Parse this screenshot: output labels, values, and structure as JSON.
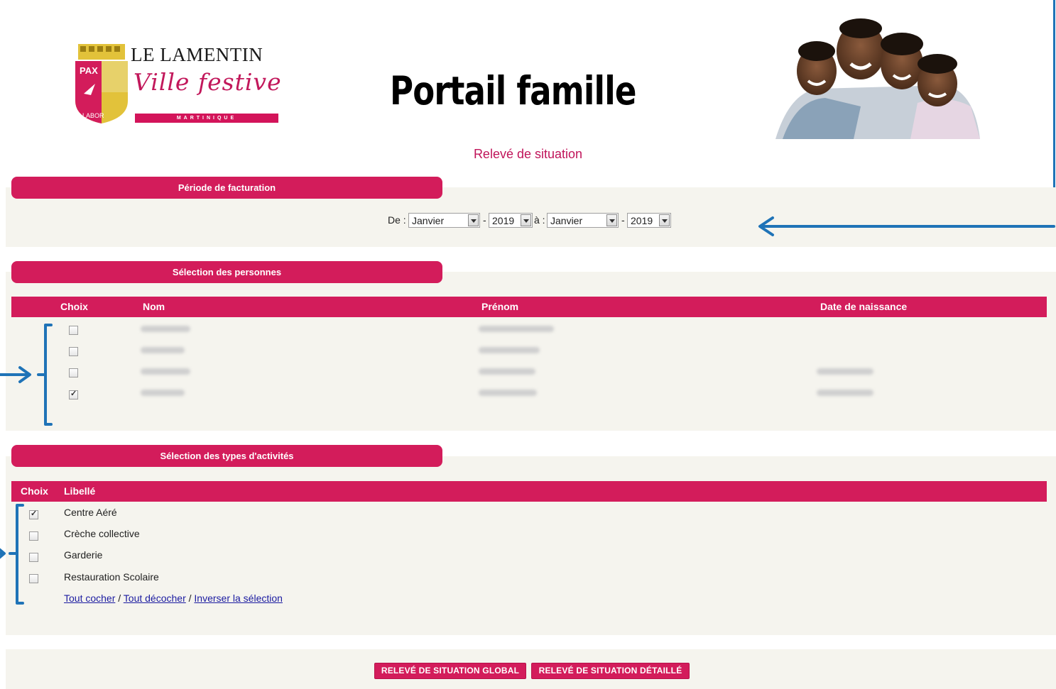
{
  "header": {
    "logo_title": "LE LAMENTIN",
    "logo_script": "Ville festive",
    "logo_banner": "MARTINIQUE",
    "shield_top": "PAX",
    "shield_bottom": "LABOR",
    "portal_title": "Portail famille",
    "page_subtitle": "Relevé de situation"
  },
  "periode": {
    "title": "Période de facturation",
    "de_label": "De :",
    "a_label": "à :",
    "dash": "-",
    "from_month": "Janvier",
    "from_year": "2019",
    "to_month": "Janvier",
    "to_year": "2019"
  },
  "personnes": {
    "title": "Sélection des personnes",
    "columns": [
      "Choix",
      "Nom",
      "Prénom",
      "Date de naissance"
    ],
    "rows": [
      {
        "checked": false
      },
      {
        "checked": false
      },
      {
        "checked": false
      },
      {
        "checked": true
      }
    ]
  },
  "activites": {
    "title": "Sélection des types d'activités",
    "columns": [
      "Choix",
      "Libellé"
    ],
    "rows": [
      {
        "label": "Centre Aéré",
        "checked": true
      },
      {
        "label": "Crèche collective",
        "checked": false
      },
      {
        "label": "Garderie",
        "checked": false
      },
      {
        "label": "Restauration Scolaire",
        "checked": false
      }
    ],
    "link_check_all": "Tout cocher",
    "link_uncheck_all": "Tout décocher",
    "link_invert": "Inverser la sélection",
    "separator": " / "
  },
  "buttons": {
    "global": "RELEVÉ DE SITUATION GLOBAL",
    "detail": "RELEVÉ DE SITUATION DÉTAILLÉ"
  },
  "colors": {
    "brand": "#d31c5b",
    "annotation": "#1f73b7",
    "section_bg": "#f5f4ee"
  }
}
